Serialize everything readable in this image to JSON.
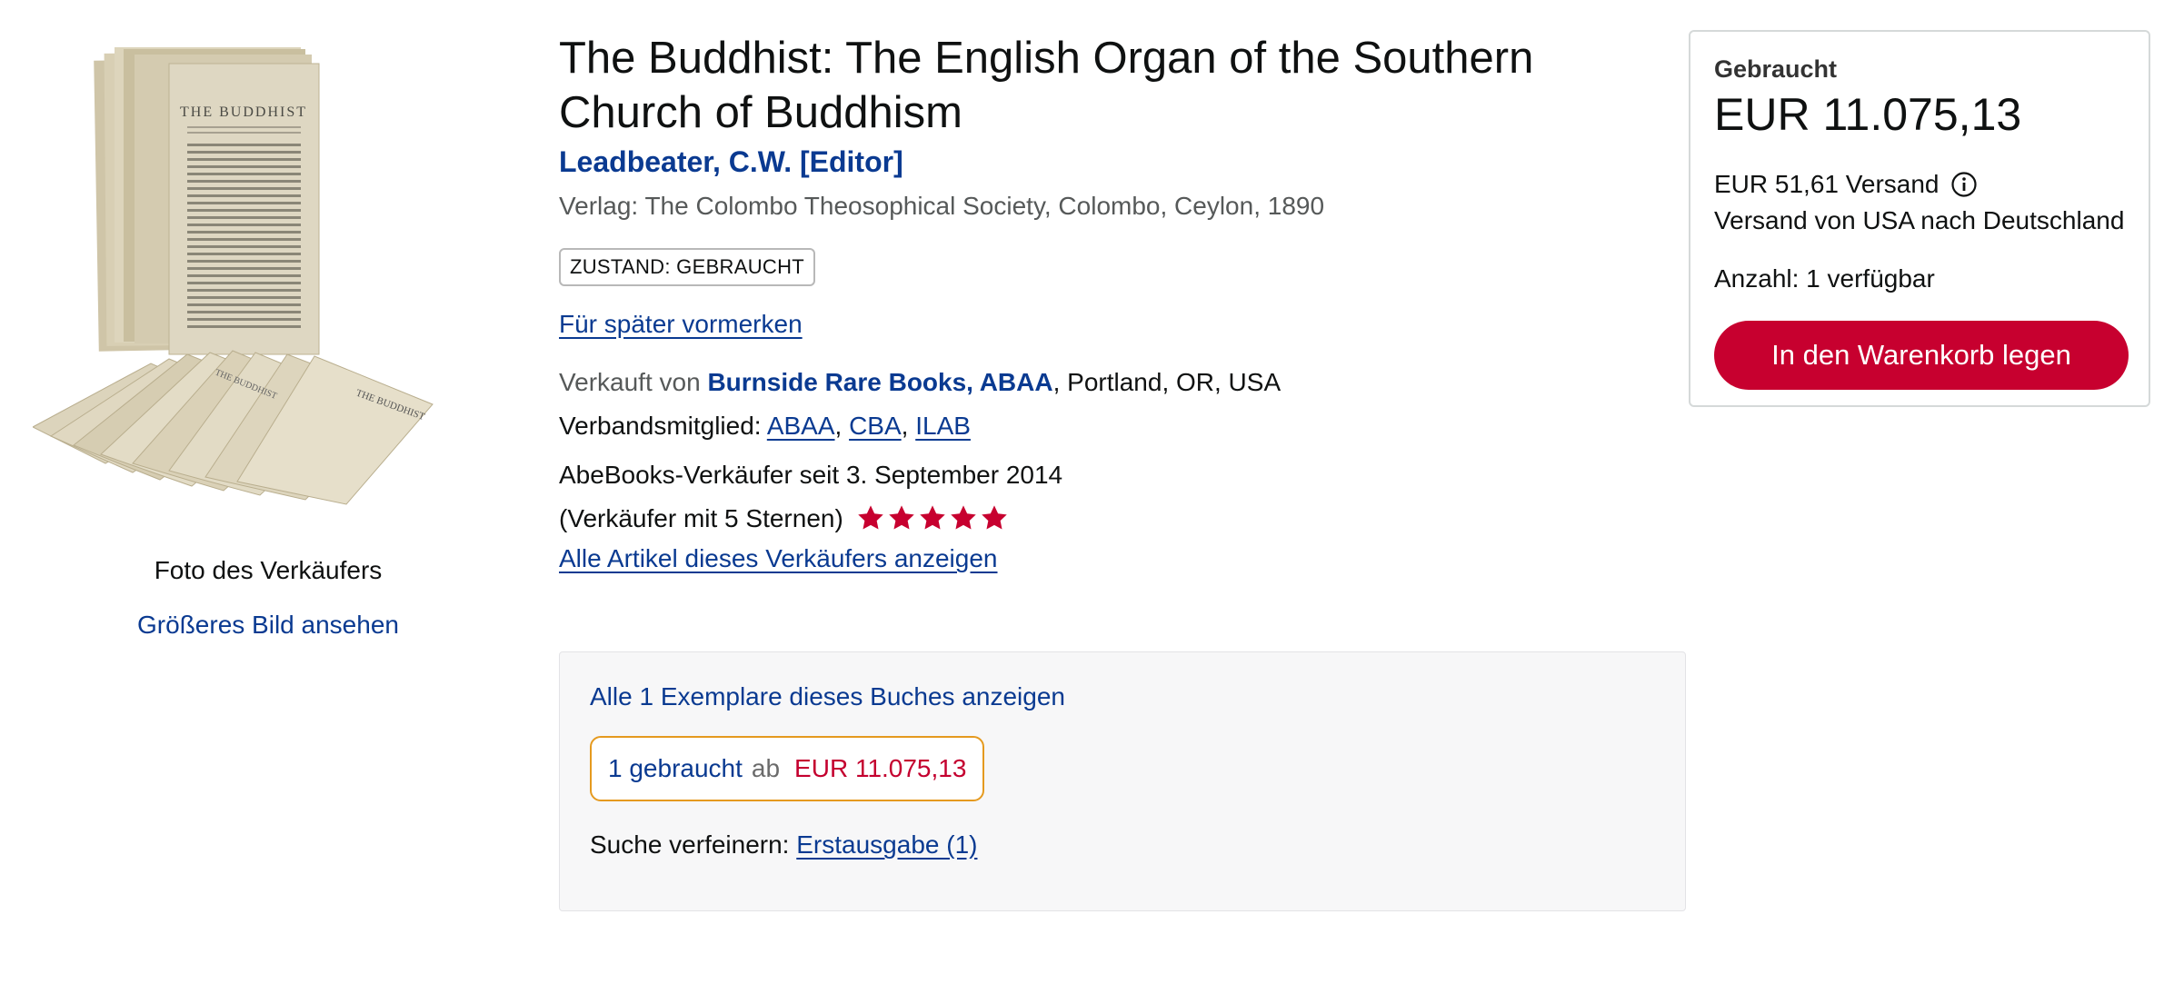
{
  "image": {
    "caption": "Foto des Verkäufers",
    "larger_image_link": "Größeres Bild ansehen"
  },
  "product": {
    "title": "The Buddhist: The English Organ of the Southern Church of Buddhism",
    "author": "Leadbeater, C.W. [Editor]",
    "publisher": "Verlag: The Colombo Theosophical Society, Colombo, Ceylon, 1890",
    "condition_badge": "ZUSTAND: GEBRAUCHT",
    "watchlist_link": "Für später vormerken"
  },
  "seller": {
    "sold_by_prefix": "Verkauft von",
    "name": "Burnside Rare Books, ABAA",
    "location": ", Portland, OR, USA",
    "membership_prefix": "Verbandsmitglied:",
    "memberships": [
      "ABAA",
      "CBA",
      "ILAB"
    ],
    "since": "AbeBooks-Verkäufer seit 3. September 2014",
    "rating_text": "(Verkäufer mit 5 Sternen)",
    "rating_stars": 5,
    "all_items_link": "Alle Artikel dieses Verkäufers anzeigen",
    "star_color": "#c7002f"
  },
  "copies": {
    "all_copies_link": "Alle 1 Exemplare dieses Buches anzeigen",
    "used_count": "1 gebraucht",
    "from_word": "ab",
    "from_price": "EUR 11.075,13",
    "refine_label": "Suche verfeinern:",
    "refine_link": "Erstausgabe (1)"
  },
  "buy_box": {
    "condition": "Gebraucht",
    "price": "EUR 11.075,13",
    "shipping": "EUR 51,61 Versand",
    "shipping_route": "Versand von USA nach Deutschland",
    "quantity": "Anzahl: 1 verfügbar",
    "add_to_cart": "In den Warenkorb legen",
    "button_color": "#c7002f"
  }
}
